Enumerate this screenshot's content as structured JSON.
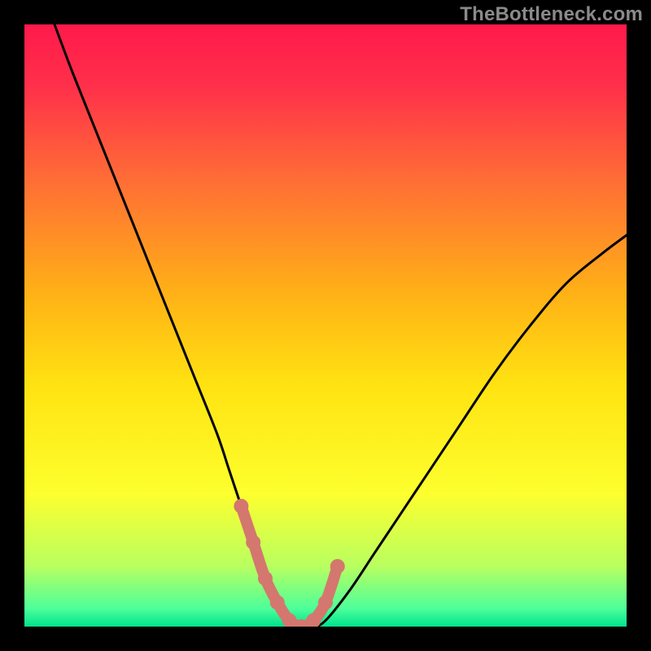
{
  "watermark": "TheBottleneck.com",
  "chart_data": {
    "type": "line",
    "title": "",
    "xlabel": "",
    "ylabel": "",
    "xlim": [
      0,
      100
    ],
    "ylim": [
      0,
      100
    ],
    "grid": false,
    "legend": false,
    "background_gradient": [
      {
        "stop": 0.0,
        "color": "#ff1a4b"
      },
      {
        "stop": 0.1,
        "color": "#ff2f4a"
      },
      {
        "stop": 0.25,
        "color": "#ff6a37"
      },
      {
        "stop": 0.45,
        "color": "#ffb216"
      },
      {
        "stop": 0.6,
        "color": "#ffe311"
      },
      {
        "stop": 0.78,
        "color": "#fdff2e"
      },
      {
        "stop": 0.9,
        "color": "#b8ff60"
      },
      {
        "stop": 0.97,
        "color": "#4dff9a"
      },
      {
        "stop": 1.0,
        "color": "#00e38c"
      }
    ],
    "series": [
      {
        "name": "bottleneck-curve",
        "stroke": "#000000",
        "x": [
          5,
          8,
          12,
          16,
          20,
          24,
          28,
          32,
          34,
          36,
          38,
          40,
          42,
          44,
          46,
          48,
          50,
          54,
          58,
          62,
          66,
          72,
          78,
          84,
          90,
          96,
          100
        ],
        "y": [
          100,
          92,
          82,
          72,
          62,
          52,
          42,
          32,
          26,
          20,
          14,
          8,
          4,
          1,
          0,
          0,
          1,
          6,
          12,
          18,
          24,
          33,
          42,
          50,
          57,
          62,
          65
        ]
      }
    ],
    "highlight": {
      "name": "sweet-spot",
      "stroke": "#d4776f",
      "points_x": [
        36,
        38,
        40,
        42,
        44,
        46,
        48,
        50,
        52
      ],
      "points_y": [
        20,
        14,
        8,
        4,
        1,
        0,
        1,
        4,
        10
      ]
    }
  }
}
